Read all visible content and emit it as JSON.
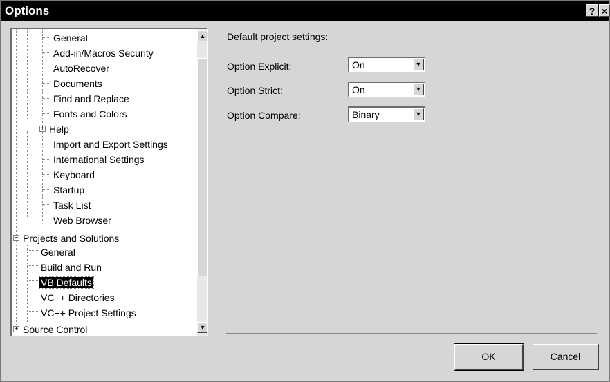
{
  "window": {
    "title": "Options",
    "help_glyph": "?",
    "close_glyph": "×"
  },
  "tree": {
    "items": [
      {
        "label": "General",
        "level": 2
      },
      {
        "label": "Add-in/Macros Security",
        "level": 2
      },
      {
        "label": "AutoRecover",
        "level": 2
      },
      {
        "label": "Documents",
        "level": 2
      },
      {
        "label": "Find and Replace",
        "level": 2
      },
      {
        "label": "Fonts and Colors",
        "level": 2
      },
      {
        "label": "Help",
        "level": 1,
        "expander": "+"
      },
      {
        "label": "Import and Export Settings",
        "level": 2
      },
      {
        "label": "International Settings",
        "level": 2
      },
      {
        "label": "Keyboard",
        "level": 2
      },
      {
        "label": "Startup",
        "level": 2
      },
      {
        "label": "Task List",
        "level": 2
      },
      {
        "label": "Web Browser",
        "level": 2
      },
      {
        "label": "Projects and Solutions",
        "level": 0,
        "expander": "−"
      },
      {
        "label": "General",
        "level": 1
      },
      {
        "label": "Build and Run",
        "level": 1
      },
      {
        "label": "VB Defaults",
        "level": 1,
        "selected": true
      },
      {
        "label": "VC++ Directories",
        "level": 1
      },
      {
        "label": "VC++ Project Settings",
        "level": 1
      },
      {
        "label": "Source Control",
        "level": 0,
        "expander": "+"
      }
    ]
  },
  "settings": {
    "heading": "Default project settings:",
    "option_explicit": {
      "label": "Option Explicit:",
      "value": "On"
    },
    "option_strict": {
      "label": "Option Strict:",
      "value": "On"
    },
    "option_compare": {
      "label": "Option Compare:",
      "value": "Binary"
    }
  },
  "buttons": {
    "ok": "OK",
    "cancel": "Cancel"
  },
  "colors": {
    "dialog_bg": "#d6d6d6",
    "titlebar_bg": "#000000",
    "selection_bg": "#000000"
  }
}
